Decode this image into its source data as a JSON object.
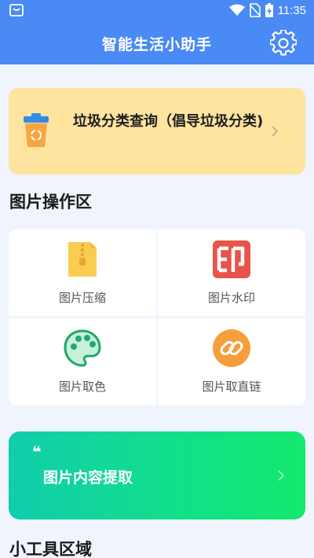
{
  "status_bar": {
    "time": "11:35",
    "icons": [
      "app-notification-icon",
      "wifi-icon",
      "no-sim-icon",
      "battery-charging-icon"
    ]
  },
  "app_bar": {
    "title": "智能生活小助手",
    "settings_icon": "gear-icon"
  },
  "garbage_card": {
    "label": "垃圾分类查询（倡导垃圾分类)",
    "icon": "trash-bin-icon",
    "accent": "#ffe4a0"
  },
  "image_section": {
    "title": "图片操作区",
    "tiles": [
      {
        "label": "图片压缩",
        "icon": "zip-file-icon"
      },
      {
        "label": "图片水印",
        "icon": "seal-print-icon"
      },
      {
        "label": "图片取色",
        "icon": "palette-icon"
      },
      {
        "label": "图片取直链",
        "icon": "link-icon"
      }
    ]
  },
  "extract_card": {
    "quote": "❝",
    "label": "图片内容提取"
  },
  "tools_section": {
    "title": "小工具区域"
  },
  "colors": {
    "primary": "#4a8af4",
    "background": "#f0f4fd",
    "watermark_red": "#e8544a",
    "link_orange": "#f59f3c",
    "palette_green": "#25c08a"
  }
}
